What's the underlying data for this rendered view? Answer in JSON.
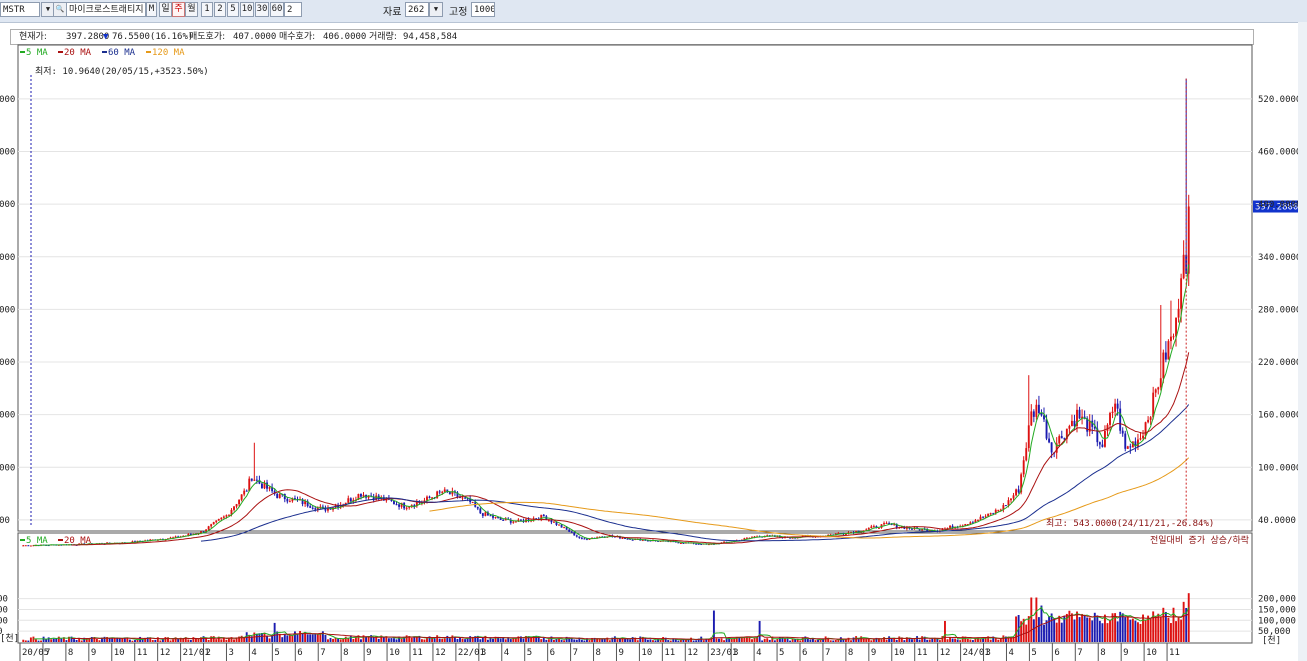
{
  "toolbar": {
    "symbol": "MSTR",
    "name": "마이크로스트래티지",
    "market_flag": "M",
    "periods": [
      "일",
      "주",
      "월"
    ],
    "active_period": "주",
    "intervals": [
      "1",
      "2",
      "5",
      "10",
      "30",
      "60"
    ],
    "interval_value": "2",
    "data_label": "자료",
    "data_count": "262",
    "fixed_label": "고정",
    "fixed_value": "1000"
  },
  "info": {
    "price_label": "현재가:",
    "price": "397.2800",
    "change": "76.5500(16.16%)",
    "ask_label": "매도호가:",
    "ask": "407.0000",
    "bid_label": "매수호가:",
    "bid": "406.0000",
    "volume_label": "거래량:",
    "volume": "94,458,584"
  },
  "colors": {
    "up": "#dd1111",
    "down": "#1b1bb0",
    "ma5": "#22aa22",
    "ma20": "#aa1111",
    "ma60": "#1b2f8f",
    "ma120": "#e69a1a",
    "current": "#1133cc"
  },
  "chart_data": [
    {
      "type": "candlestick",
      "legend": [
        "5 MA",
        "20 MA",
        "60 MA",
        "120 MA"
      ],
      "legend_placement": "top-left",
      "y_axis_labels": [
        "520.0000",
        "460.0000",
        "400.0000",
        "340.0000",
        "280.0000",
        "220.0000",
        "160.0000",
        "100.0000",
        "40.0000"
      ],
      "ylim": [
        0,
        560
      ],
      "current_price_label": "397.2800",
      "annotations": {
        "low": "최저: 10.9640(20/05/15,+3523.50%)",
        "high": "최고: 543.0000(24/11/21,-26.84%)"
      },
      "x_ticks": [
        "20/05",
        "7",
        "8",
        "9",
        "10",
        "11",
        "12",
        "21/01",
        "2",
        "3",
        "4",
        "5",
        "6",
        "7",
        "8",
        "9",
        "10",
        "11",
        "12",
        "22/01",
        "3",
        "4",
        "5",
        "6",
        "7",
        "8",
        "9",
        "10",
        "11",
        "12",
        "23/01",
        "3",
        "4",
        "5",
        "6",
        "7",
        "8",
        "9",
        "10",
        "11",
        "12",
        "24/01",
        "3",
        "4",
        "5",
        "6",
        "7",
        "8",
        "9",
        "10",
        "11"
      ],
      "knots": [
        [
          0,
          11
        ],
        [
          20,
          12
        ],
        [
          40,
          14
        ],
        [
          60,
          20
        ],
        [
          70,
          26
        ],
        [
          80,
          45
        ],
        [
          88,
          75
        ],
        [
          90,
          90
        ],
        [
          93,
          82
        ],
        [
          100,
          68
        ],
        [
          110,
          60
        ],
        [
          118,
          52
        ],
        [
          125,
          58
        ],
        [
          133,
          70
        ],
        [
          140,
          65
        ],
        [
          150,
          56
        ],
        [
          158,
          62
        ],
        [
          165,
          72
        ],
        [
          170,
          68
        ],
        [
          176,
          60
        ],
        [
          180,
          48
        ],
        [
          188,
          40
        ],
        [
          195,
          38
        ],
        [
          205,
          44
        ],
        [
          212,
          32
        ],
        [
          220,
          18
        ],
        [
          230,
          22
        ],
        [
          240,
          18
        ],
        [
          250,
          16
        ],
        [
          260,
          14
        ],
        [
          270,
          12
        ],
        [
          280,
          16
        ],
        [
          290,
          22
        ],
        [
          300,
          20
        ],
        [
          315,
          22
        ],
        [
          330,
          28
        ],
        [
          340,
          35
        ],
        [
          350,
          30
        ],
        [
          360,
          28
        ],
        [
          370,
          35
        ],
        [
          380,
          45
        ],
        [
          386,
          55
        ],
        [
          392,
          75
        ],
        [
          397,
          160
        ],
        [
          400,
          170
        ],
        [
          405,
          120
        ],
        [
          410,
          140
        ],
        [
          415,
          160
        ],
        [
          420,
          145
        ],
        [
          425,
          125
        ],
        [
          430,
          175
        ],
        [
          434,
          120
        ],
        [
          440,
          135
        ],
        [
          445,
          175
        ],
        [
          450,
          230
        ],
        [
          454,
          260
        ],
        [
          456,
          330
        ],
        [
          458,
          397
        ]
      ]
    },
    {
      "type": "bar",
      "legend": [
        "5 MA",
        "20 MA"
      ],
      "right_label": "전일대비 증가 상승/하락",
      "y_axis_labels": [
        "200,000",
        "150,000",
        "100,000",
        "50,000"
      ],
      "unit": "[천]",
      "ylim": [
        0,
        220000
      ]
    }
  ]
}
